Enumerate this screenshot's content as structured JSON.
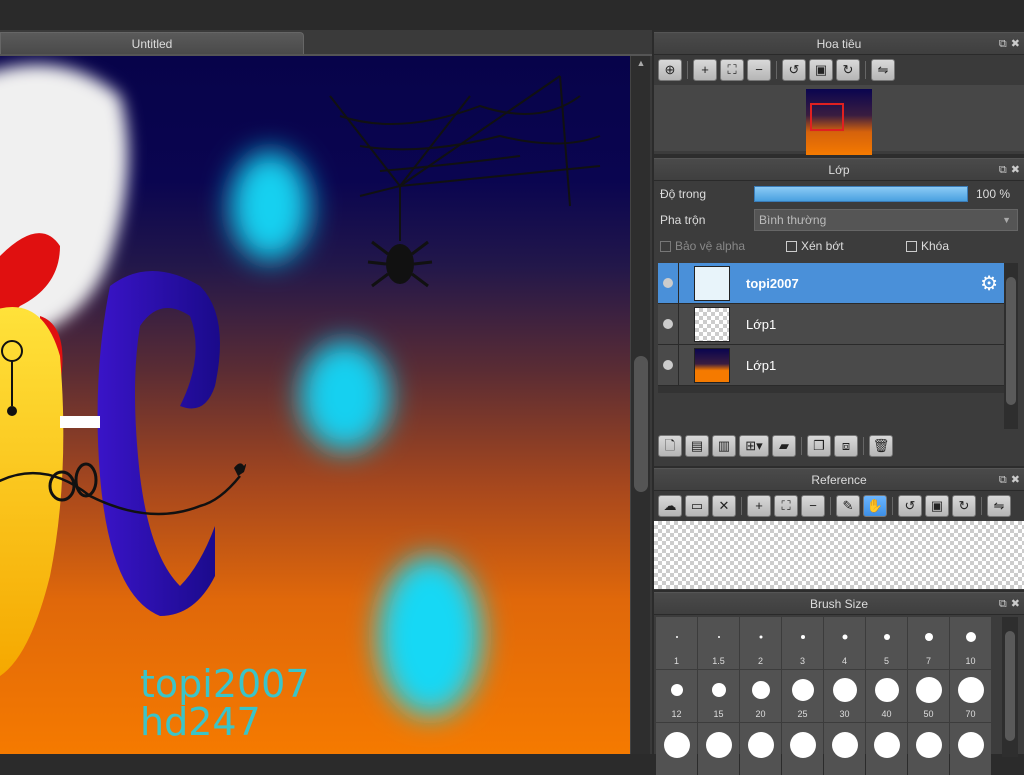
{
  "document": {
    "tab_title": "Untitled"
  },
  "canvas": {
    "watermark_line1": "topi2007",
    "watermark_line2": "hd247"
  },
  "navigator": {
    "title": "Hoa tiêu",
    "tools": [
      "zoom-fit-icon",
      "zoom-in-icon",
      "fit-screen-icon",
      "zoom-out-icon",
      "rotate-left-icon",
      "reset-rotation-icon",
      "rotate-right-icon",
      "flip-icon"
    ]
  },
  "layers": {
    "title": "Lớp",
    "opacity_label": "Độ trong",
    "opacity_value": "100 %",
    "opacity_fraction": 1.0,
    "blend_label": "Pha trộn",
    "blend_value": "Bình thường",
    "protect_alpha": "Bảo vệ alpha",
    "clipping": "Xén bớt",
    "lock": "Khóa",
    "items": [
      {
        "name": "topi2007",
        "selected": true
      },
      {
        "name": "Lớp1",
        "selected": false
      },
      {
        "name": "Lớp1",
        "selected": false
      }
    ]
  },
  "reference": {
    "title": "Reference"
  },
  "brush_size": {
    "title": "Brush Size",
    "sizes": [
      "1",
      "1.5",
      "2",
      "3",
      "4",
      "5",
      "7",
      "10",
      "12",
      "15",
      "20",
      "25",
      "30",
      "40",
      "50",
      "70",
      "",
      "",
      "",
      "",
      "",
      "",
      "",
      ""
    ]
  },
  "colors": {
    "accent": "#4a90d9",
    "selection_red": "#e02020",
    "watermark": "#3bc4c8"
  }
}
